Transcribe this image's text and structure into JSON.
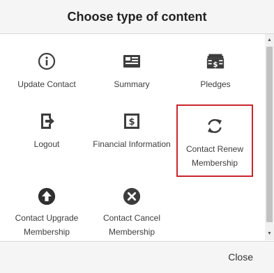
{
  "dialog": {
    "title": "Choose type of content",
    "close_label": "Close"
  },
  "tiles": [
    {
      "label": "Update Contact",
      "icon": "info-circle-icon",
      "selected": false
    },
    {
      "label": "Summary",
      "icon": "summary-card-icon",
      "selected": false
    },
    {
      "label": "Pledges",
      "icon": "pledges-stack-icon",
      "selected": false
    },
    {
      "label": "Logout",
      "icon": "logout-icon",
      "selected": false
    },
    {
      "label": "Financial Information",
      "icon": "dollar-document-icon",
      "selected": false
    },
    {
      "label": "Contact Renew Membership",
      "icon": "renew-sync-icon",
      "selected": true
    },
    {
      "label": "Contact Upgrade Membership",
      "icon": "arrow-up-circle-icon",
      "selected": false
    },
    {
      "label": "Contact Cancel Membership",
      "icon": "cancel-circle-icon",
      "selected": false
    }
  ],
  "colors": {
    "icon": "#3d3d3d",
    "selected_border": "#c9252c"
  }
}
